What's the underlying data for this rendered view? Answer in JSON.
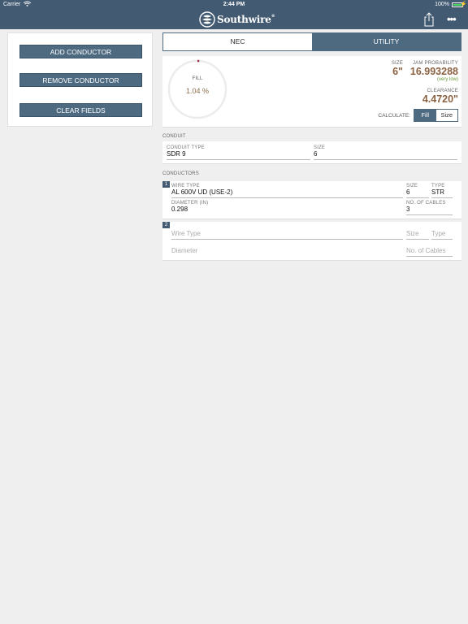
{
  "status": {
    "carrier": "Carrier",
    "time": "2:44 PM",
    "battery": "100%"
  },
  "nav": {
    "brand": "Southwire",
    "reg": "®",
    "more": "•••"
  },
  "left": {
    "add_label": "ADD CONDUCTOR",
    "remove_label": "REMOVE CONDUCTOR",
    "clear_label": "CLEAR FIELDS"
  },
  "tabs": [
    {
      "label": "NEC"
    },
    {
      "label": "UTILITY"
    }
  ],
  "results": {
    "fill_label": "FILL",
    "fill_value": "1.04 %",
    "fill_fraction": 0.0104,
    "size_label": "SIZE",
    "size_value": "6\"",
    "jam_label": "JAM PROBABILITY",
    "jam_value": "16.993288",
    "jam_sub": "(very low)",
    "clearance_label": "CLEARANCE",
    "clearance_value": "4.4720\"",
    "calculate_label": "CALCULATE:",
    "calc_options": [
      "Fill",
      "Size"
    ]
  },
  "conduit": {
    "section": "CONDUIT",
    "type_label": "CONDUIT TYPE",
    "type_value": "SDR 9",
    "size_label": "SIZE",
    "size_value": "6"
  },
  "conductors": {
    "section": "CONDUCTORS",
    "items": [
      {
        "index": "1",
        "wire_type_label": "WIRE TYPE",
        "wire_type_value": "AL 600V UD (USE-2)",
        "size_label": "SIZE",
        "size_value": "6",
        "type_label": "TYPE",
        "type_value": "STR",
        "diameter_label": "DIAMETER (IN)",
        "diameter_value": "0.298",
        "cables_label": "NO. OF CABLES",
        "cables_value": "3"
      },
      {
        "index": "2",
        "wire_type_placeholder": "Wire Type",
        "size_placeholder": "Size",
        "type_placeholder": "Type",
        "diameter_placeholder": "Diameter",
        "cables_placeholder": "No. of Cables"
      }
    ]
  },
  "colors": {
    "brand": "#425a72",
    "button": "#4e6a81",
    "value": "#8b6142",
    "jam_ok": "#6a9a3a",
    "gauge_mark": "#a0304a"
  }
}
